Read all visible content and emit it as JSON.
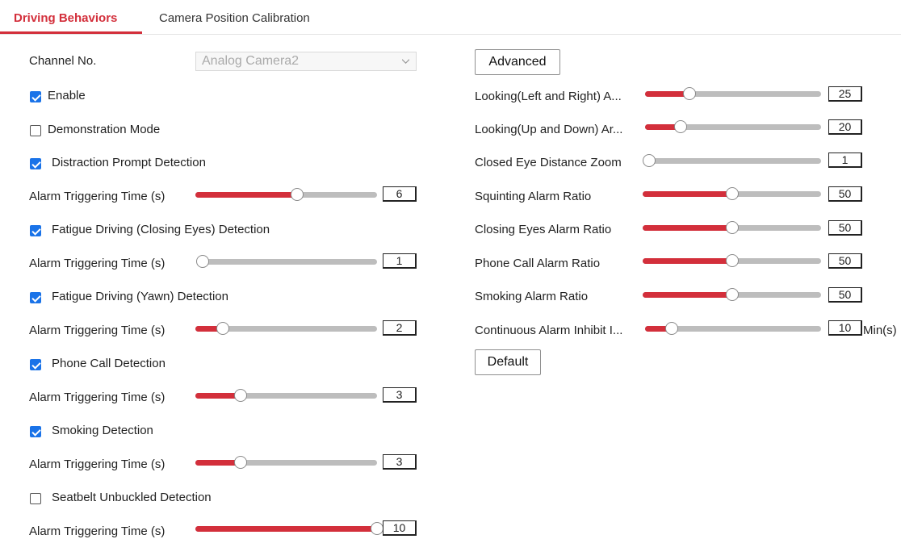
{
  "tabs": [
    {
      "label": "Driving Behaviors"
    },
    {
      "label": "Camera Position Calibration"
    }
  ],
  "left": {
    "channel_label": "Channel No.",
    "channel_value": "Analog Camera2",
    "enable": {
      "label": "Enable",
      "checked": true
    },
    "demo": {
      "label": "Demonstration Mode",
      "checked": false
    },
    "distraction": {
      "label": "Distraction Prompt Detection",
      "checked": true,
      "alarm_label": "Alarm Triggering Time (s)",
      "value": "6"
    },
    "fatigue_eyes": {
      "label": "Fatigue Driving (Closing Eyes) Detection",
      "checked": true,
      "alarm_label": "Alarm Triggering Time (s)",
      "value": "1"
    },
    "fatigue_yawn": {
      "label": "Fatigue Driving (Yawn) Detection",
      "checked": true,
      "alarm_label": "Alarm Triggering Time (s)",
      "value": "2"
    },
    "phone": {
      "label": "Phone Call Detection",
      "checked": true,
      "alarm_label": "Alarm Triggering Time (s)",
      "value": "3"
    },
    "smoking": {
      "label": "Smoking Detection",
      "checked": true,
      "alarm_label": "Alarm Triggering Time (s)",
      "value": "3"
    },
    "seatbelt": {
      "label": "Seatbelt Unbuckled Detection",
      "checked": false,
      "alarm_label": "Alarm Triggering Time (s)",
      "value": "10"
    }
  },
  "right": {
    "advanced_label": "Advanced",
    "looking_lr": {
      "label": "Looking(Left and Right) A...",
      "value": "25"
    },
    "looking_ud": {
      "label": "Looking(Up and Down) Ar...",
      "value": "20"
    },
    "closed_eye_zoom": {
      "label": "Closed Eye Distance Zoom",
      "value": "1"
    },
    "squinting": {
      "label": "Squinting Alarm Ratio",
      "value": "50"
    },
    "closing_eyes": {
      "label": "Closing Eyes Alarm Ratio",
      "value": "50"
    },
    "phone_ratio": {
      "label": "Phone Call Alarm Ratio",
      "value": "50"
    },
    "smoking_ratio": {
      "label": "Smoking Alarm Ratio",
      "value": "50"
    },
    "inhibit": {
      "label": "Continuous Alarm Inhibit I...",
      "value": "10",
      "unit": "Min(s)"
    },
    "default_label": "Default"
  },
  "slider_levels": {
    "distraction": 0.56,
    "fatigue_eyes": 0.0,
    "fatigue_yawn": 0.15,
    "phone": 0.25,
    "smoking": 0.25,
    "seatbelt": 1.0,
    "looking_lr": 0.25,
    "looking_ud": 0.2,
    "closed_eye_zoom": 0.0,
    "squinting": 0.5,
    "closing_eyes": 0.5,
    "phone_ratio": 0.5,
    "smoking_ratio": 0.5,
    "inhibit": 0.15
  },
  "colors": {
    "accent": "#d32f3b",
    "checkbox": "#1a73e8",
    "track": "#bdbdbd"
  }
}
